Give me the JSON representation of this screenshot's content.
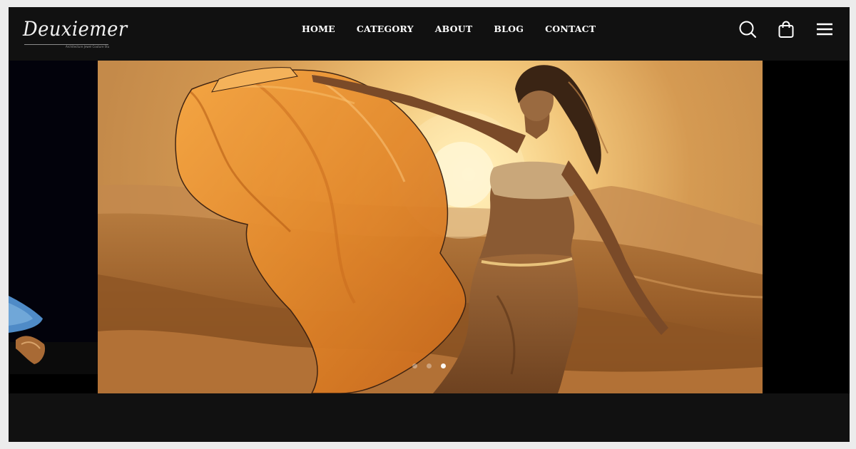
{
  "brand": {
    "logo_text": "Deuxiemer",
    "tagline": "Architecture Jewel Couture Stu"
  },
  "nav": {
    "items": [
      {
        "label": "HOME"
      },
      {
        "label": "CATEGORY"
      },
      {
        "label": "ABOUT"
      },
      {
        "label": "BLOG"
      },
      {
        "label": "CONTACT"
      }
    ]
  },
  "header_icons": [
    "search-icon",
    "shopping-bag-icon",
    "hamburger-menu-icon"
  ],
  "slider": {
    "slide_count": 3,
    "active_index": 2
  },
  "colors": {
    "header_bg": "#111111",
    "page_bg": "#ececec",
    "sky_glow": "#ffe3a0",
    "dune": "#a5692c",
    "fabric": "#e9902f"
  }
}
